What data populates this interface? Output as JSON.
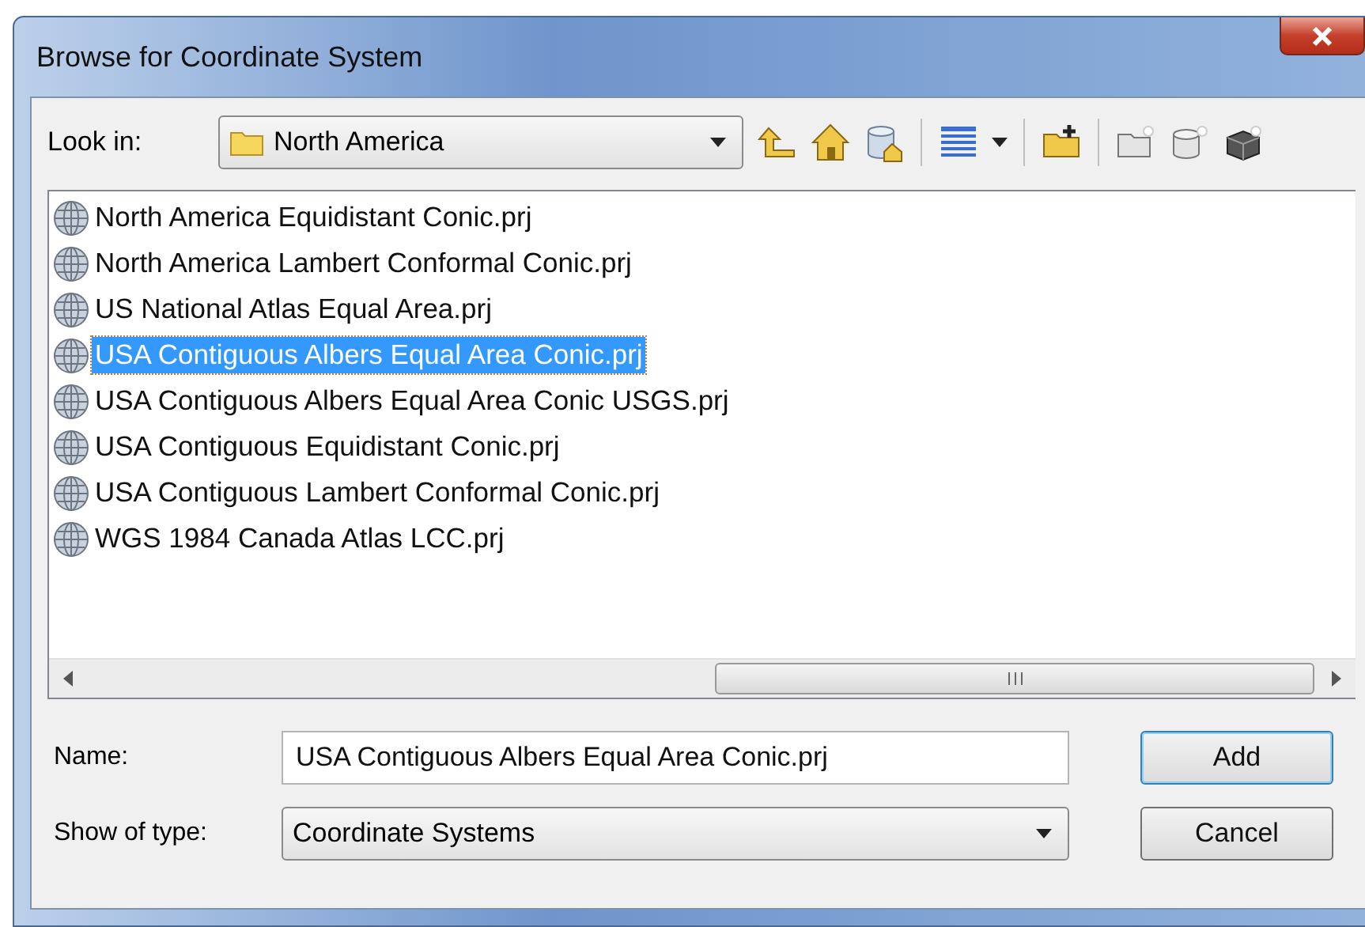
{
  "window": {
    "title": "Browse for Coordinate System"
  },
  "look_in": {
    "label": "Look in:",
    "value": "North America"
  },
  "files": [
    {
      "name": "North America Equidistant Conic.prj",
      "selected": false
    },
    {
      "name": "North America Lambert Conformal Conic.prj",
      "selected": false
    },
    {
      "name": "US National Atlas Equal Area.prj",
      "selected": false
    },
    {
      "name": "USA Contiguous Albers Equal Area Conic.prj",
      "selected": true
    },
    {
      "name": "USA Contiguous Albers Equal Area Conic USGS.prj",
      "selected": false
    },
    {
      "name": "USA Contiguous Equidistant Conic.prj",
      "selected": false
    },
    {
      "name": "USA Contiguous Lambert Conformal Conic.prj",
      "selected": false
    },
    {
      "name": "WGS 1984 Canada Atlas LCC.prj",
      "selected": false
    }
  ],
  "name_field": {
    "label": "Name:",
    "value": "USA Contiguous Albers Equal Area Conic.prj"
  },
  "type_field": {
    "label": "Show of type:",
    "value": "Coordinate Systems"
  },
  "buttons": [
    {
      "label": "Add",
      "default": true
    },
    {
      "label": "Cancel",
      "default": false
    }
  ]
}
